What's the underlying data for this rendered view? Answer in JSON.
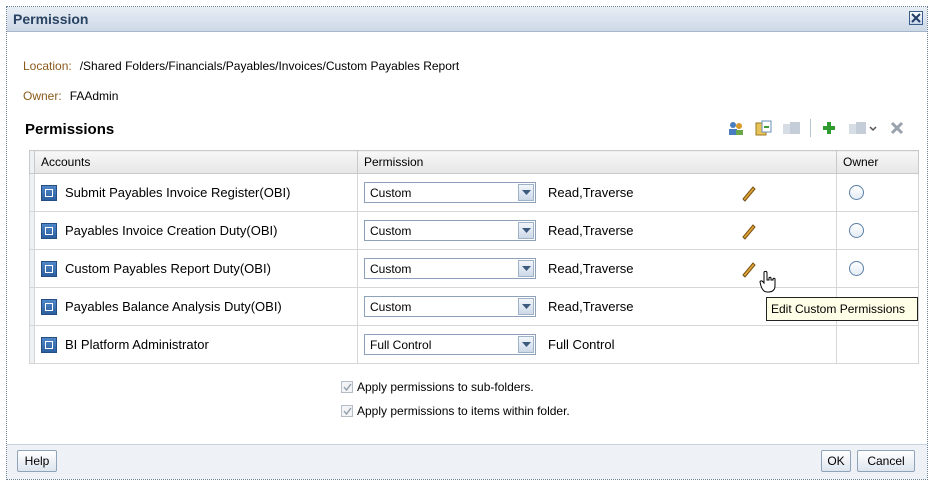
{
  "dialog": {
    "title": "Permission"
  },
  "info": {
    "location_label": "Location:",
    "location_value": "/Shared Folders/Financials/Payables/Invoices/Custom Payables Report",
    "owner_label": "Owner:",
    "owner_value": "FAAdmin"
  },
  "permissions": {
    "title": "Permissions",
    "headers": {
      "accounts": "Accounts",
      "permission": "Permission",
      "owner": "Owner"
    },
    "rows": [
      {
        "account": "Submit Payables Invoice Register(OBI)",
        "select": "Custom",
        "perm_text": "Read,Traverse"
      },
      {
        "account": "Payables Invoice Creation Duty(OBI)",
        "select": "Custom",
        "perm_text": "Read,Traverse"
      },
      {
        "account": "Custom Payables Report Duty(OBI)",
        "select": "Custom",
        "perm_text": "Read,Traverse"
      },
      {
        "account": "Payables Balance Analysis Duty(OBI)",
        "select": "Custom",
        "perm_text": "Read,Traverse"
      },
      {
        "account": "BI Platform Administrator",
        "select": "Full Control",
        "perm_text": "Full Control"
      }
    ]
  },
  "options": {
    "subfolders": "Apply permissions to sub-folders.",
    "items": "Apply permissions to items within folder."
  },
  "tooltip": {
    "text": "Edit Custom Permissions"
  },
  "footer": {
    "help": "Help",
    "ok": "OK",
    "cancel": "Cancel"
  },
  "colors": {
    "label": "#8b5a1c",
    "title": "#2a4363",
    "accent": "#3a5d8a"
  },
  "icons": [
    "close-icon",
    "add-users-icon",
    "copy-permissions-icon",
    "paste-permissions-icon",
    "add-icon",
    "paste-dropdown-icon",
    "delete-icon",
    "account-icon",
    "edit-icon",
    "dropdown-arrow-icon"
  ]
}
